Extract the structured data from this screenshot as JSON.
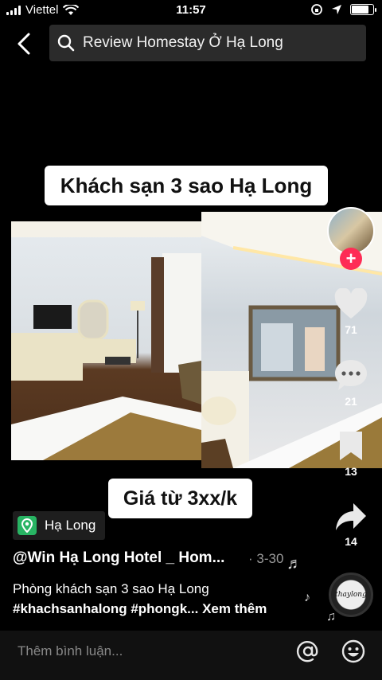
{
  "status_bar": {
    "carrier": "Viettel",
    "time": "11:57",
    "battery_level": 0.8
  },
  "search": {
    "query": "Review Homestay Ở Hạ Long"
  },
  "video": {
    "caption_top": "Khách sạn 3 sao Hạ Long",
    "caption_bottom": "Giá từ 3xx/k"
  },
  "actions": {
    "likes": "71",
    "comments": "21",
    "saves": "13",
    "shares": "14"
  },
  "post": {
    "location": "Hạ Long",
    "author": "@Win Hạ Long Hotel _ Hom...",
    "date": "· 3-30",
    "description": "Phòng khách sạn 3 sao Hạ Long",
    "hashtags": "#khachsanhalong #phongk...",
    "see_more": "Xem thêm"
  },
  "music": {
    "disc_label": "thaylong"
  },
  "comment_bar": {
    "placeholder": "Thêm bình luận..."
  },
  "colors": {
    "plus": "#fe2c55",
    "location_pin": "#28b463"
  }
}
